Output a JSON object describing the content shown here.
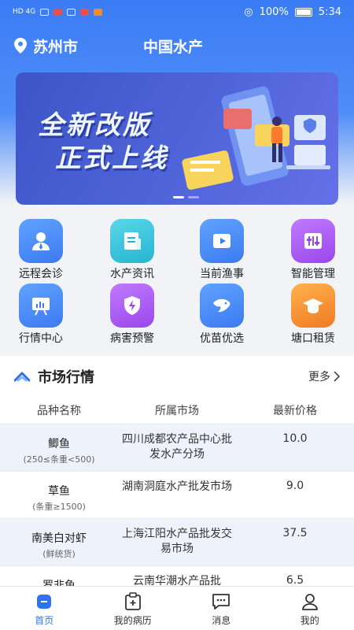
{
  "status_bar": {
    "left": "HD 4G",
    "battery": "100%",
    "time": "5:34"
  },
  "header": {
    "city": "苏州市",
    "title": "中国水产"
  },
  "banner": {
    "line1": "全新改版",
    "line2": "正式上线"
  },
  "grid": [
    {
      "label": "远程会诊",
      "icon": "doctor-icon",
      "color": "#3d8af7"
    },
    {
      "label": "水产资讯",
      "icon": "news-icon",
      "color": "#2ebfd8"
    },
    {
      "label": "当前渔事",
      "icon": "video-icon",
      "color": "#3d8af7"
    },
    {
      "label": "智能管理",
      "icon": "control-panel-icon",
      "color": "#a85bf0"
    },
    {
      "label": "行情中心",
      "icon": "chart-board-icon",
      "color": "#3d8af7"
    },
    {
      "label": "病害预警",
      "icon": "shield-warning-icon",
      "color": "#a85bf0"
    },
    {
      "label": "优苗优选",
      "icon": "fish-icon",
      "color": "#3d8af7"
    },
    {
      "label": "塘口租赁",
      "icon": "graduation-cap-icon",
      "color": "#f28b2c"
    }
  ],
  "market": {
    "title": "市场行情",
    "more": "更多",
    "columns": [
      "品种名称",
      "所属市场",
      "最新价格"
    ],
    "rows": [
      {
        "name": "鲫鱼",
        "sub": "(250≤条重<500)",
        "market": "四川成都农产品中心批发水产分场",
        "price": "10.0"
      },
      {
        "name": "草鱼",
        "sub": "(条重≥1500)",
        "market": "湖南洞庭水产批发市场",
        "price": "9.0"
      },
      {
        "name": "南美白对虾",
        "sub": "(鲜统货)",
        "market": "上海江阳水产品批发交易市场",
        "price": "37.5"
      },
      {
        "name": "罗非鱼",
        "sub": "",
        "market": "云南华潮水产品批",
        "price": "6.5"
      }
    ]
  },
  "tabs": [
    {
      "label": "首页",
      "icon": "home-icon"
    },
    {
      "label": "我的病历",
      "icon": "medical-record-icon"
    },
    {
      "label": "消息",
      "icon": "message-icon"
    },
    {
      "label": "我的",
      "icon": "user-icon"
    }
  ],
  "colors": {
    "primary": "#2f72f0",
    "header": "#3b7cf5"
  }
}
